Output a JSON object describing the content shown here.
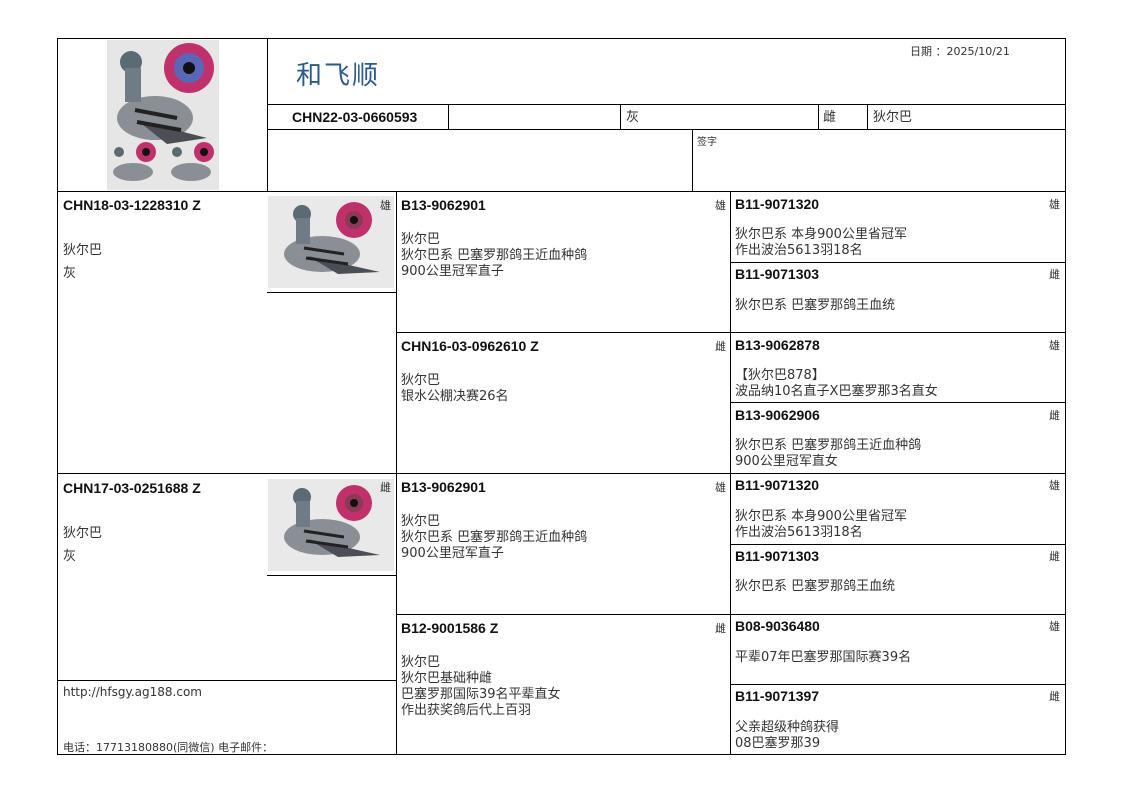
{
  "date_label": "日期 ：2025/10/21",
  "owner": "和飞顺",
  "main": {
    "ring": "CHN22-03-0660593",
    "color": "灰",
    "sex_label": "雌",
    "strain": "狄尔巴",
    "sign_label": "签字"
  },
  "sire": {
    "ring": "CHN18-03-1228310 Z",
    "line1": "狄尔巴",
    "line2": "灰",
    "sex": "雄"
  },
  "dam": {
    "ring": "CHN17-03-0251688 Z",
    "line1": "狄尔巴",
    "line2": "灰",
    "sex": "雌"
  },
  "g2": [
    {
      "ring": "B13-9062901",
      "sex": "雄",
      "lines": [
        "狄尔巴",
        "狄尔巴系 巴塞罗那鸽王近血种鸽",
        "900公里冠军直子"
      ]
    },
    {
      "ring": "CHN16-03-0962610 Z",
      "sex": "雌",
      "lines": [
        "狄尔巴",
        "银水公棚决赛26名"
      ]
    },
    {
      "ring": "B13-9062901",
      "sex": "雄",
      "lines": [
        "狄尔巴",
        "狄尔巴系 巴塞罗那鸽王近血种鸽",
        "900公里冠军直子"
      ]
    },
    {
      "ring": "B12-9001586 Z",
      "sex": "雌",
      "lines": [
        "狄尔巴",
        "狄尔巴基础种雌",
        "巴塞罗那国际39名平辈直女",
        "作出获奖鸽后代上百羽"
      ]
    }
  ],
  "g3": [
    {
      "ring": "B11-9071320",
      "sex": "雄",
      "lines": [
        "狄尔巴系 本身900公里省冠军",
        "作出波治5613羽18名"
      ]
    },
    {
      "ring": "B11-9071303",
      "sex": "雌",
      "lines": [
        "狄尔巴系 巴塞罗那鸽王血统"
      ]
    },
    {
      "ring": "B13-9062878",
      "sex": "雄",
      "lines": [
        "【狄尔巴878】",
        "波品纳10名直子X巴塞罗那3名直女"
      ]
    },
    {
      "ring": "B13-9062906",
      "sex": "雌",
      "lines": [
        "狄尔巴系 巴塞罗那鸽王近血种鸽",
        "900公里冠军直女"
      ]
    },
    {
      "ring": "B11-9071320",
      "sex": "雄",
      "lines": [
        "狄尔巴系 本身900公里省冠军",
        "作出波治5613羽18名"
      ]
    },
    {
      "ring": "B11-9071303",
      "sex": "雌",
      "lines": [
        "狄尔巴系 巴塞罗那鸽王血统"
      ]
    },
    {
      "ring": "B08-9036480",
      "sex": "雄",
      "lines": [
        "平辈07年巴塞罗那国际赛39名"
      ]
    },
    {
      "ring": "B11-9071397",
      "sex": "雌",
      "lines": [
        "父亲超级种鸽获得",
        "08巴塞罗那39"
      ]
    }
  ],
  "footer": {
    "url": "http://hfsgy.ag188.com",
    "contact": "电话：17713180880(同微信)  电子邮件："
  },
  "icons": {
    "pigeon": "pigeon-photo",
    "eye": "eye-photo"
  },
  "colors": {
    "title": "#2a5b8c",
    "eye": "#c0306a",
    "pigeon": "#8a8f96"
  }
}
